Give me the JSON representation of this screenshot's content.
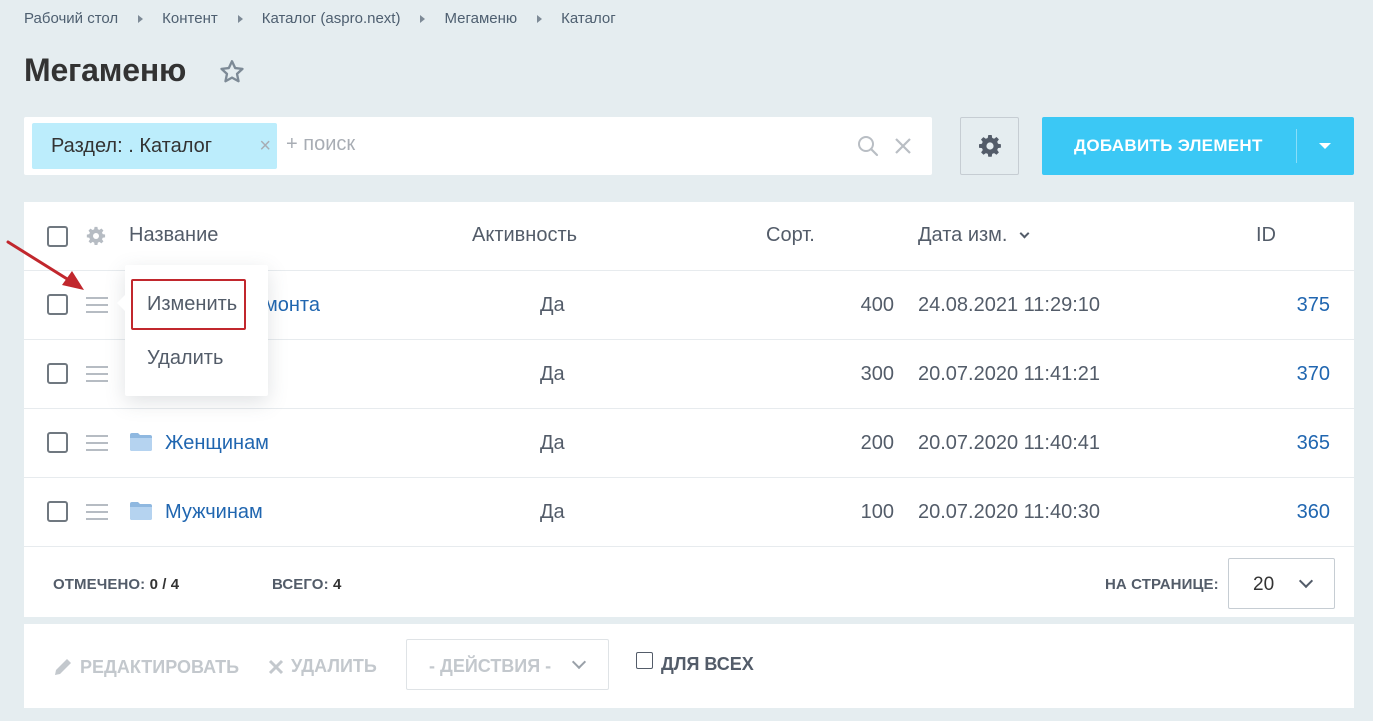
{
  "breadcrumb": [
    "Рабочий стол",
    "Контент",
    "Каталог (aspro.next)",
    "Мегаменю",
    "Каталог"
  ],
  "page": {
    "title": "Мегаменю"
  },
  "filter": {
    "chip_label": "Раздел: . Каталог",
    "search_placeholder": "+ поиск"
  },
  "add_button": {
    "label": "ДОБАВИТЬ ЭЛЕМЕНТ"
  },
  "table": {
    "columns": {
      "name": "Название",
      "active": "Активность",
      "sort": "Сорт.",
      "date": "Дата изм.",
      "id": "ID"
    },
    "rows": [
      {
        "name": "монта",
        "active": "Да",
        "sort": "400",
        "date": "24.08.2021 11:29:10",
        "id": "375"
      },
      {
        "name": "",
        "active": "Да",
        "sort": "300",
        "date": "20.07.2020 11:41:21",
        "id": "370"
      },
      {
        "name": "Женщинам",
        "active": "Да",
        "sort": "200",
        "date": "20.07.2020 11:40:41",
        "id": "365"
      },
      {
        "name": "Мужчинам",
        "active": "Да",
        "sort": "100",
        "date": "20.07.2020 11:40:30",
        "id": "360"
      }
    ]
  },
  "footer": {
    "checked_label": "ОТМЕЧЕНО:",
    "checked_value": "0 / 4",
    "total_label": "ВСЕГО:",
    "total_value": "4",
    "per_page_label": "НА СТРАНИЦЕ:",
    "per_page_value": "20"
  },
  "actions": {
    "edit": "РЕДАКТИРОВАТЬ",
    "delete": "УДАЛИТЬ",
    "select": "- ДЕЙСТВИЯ -",
    "for_all": "ДЛЯ ВСЕХ"
  },
  "context_menu": {
    "edit": "Изменить",
    "delete": "Удалить"
  },
  "colors": {
    "accent": "#3bc8f5",
    "link": "#2066b0",
    "highlight": "#c1272d",
    "chip": "#bcedfc"
  }
}
